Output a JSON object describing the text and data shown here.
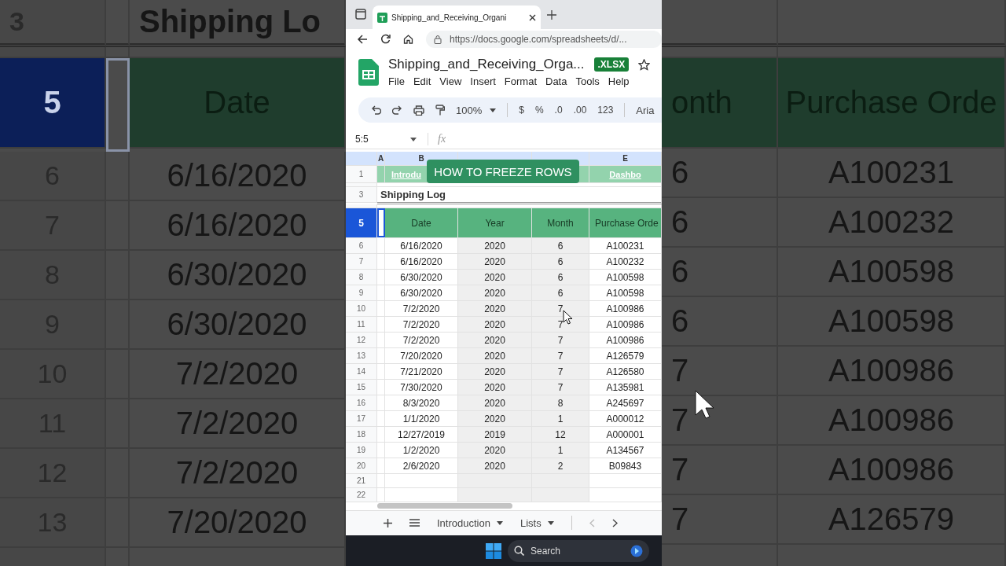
{
  "browser": {
    "tab_title": "Shipping_and_Receiving_Organi",
    "url": "https://docs.google.com/spreadsheets/d/..."
  },
  "document": {
    "title": "Shipping_and_Receiving_Orga...",
    "badge": ".XLSX",
    "menu": [
      "File",
      "Edit",
      "View",
      "Insert",
      "Format",
      "Data",
      "Tools",
      "Help"
    ]
  },
  "toolbar": {
    "zoom": "100%",
    "items": [
      "$",
      "%",
      ".0",
      ".00",
      "123"
    ],
    "font": "Aria"
  },
  "formula_bar": {
    "range": "5:5",
    "fx": "fx"
  },
  "caption": "HOW TO FREEZE ROWS",
  "sheet": {
    "column_a": "A",
    "columns": [
      "B",
      null,
      null,
      "E"
    ],
    "link_row": {
      "number": "1",
      "links": [
        "Introdu",
        "Dashbo"
      ]
    },
    "title_row": {
      "number": "3",
      "text": "Shipping Log"
    },
    "header_row": {
      "number": "5",
      "selected": true,
      "cells": [
        "Date",
        "Year",
        "Month",
        "Purchase Orde"
      ]
    },
    "rows": [
      {
        "number": "6",
        "cells": [
          "6/16/2020",
          "2020",
          "6",
          "A100231"
        ]
      },
      {
        "number": "7",
        "cells": [
          "6/16/2020",
          "2020",
          "6",
          "A100232"
        ]
      },
      {
        "number": "8",
        "cells": [
          "6/30/2020",
          "2020",
          "6",
          "A100598"
        ]
      },
      {
        "number": "9",
        "cells": [
          "6/30/2020",
          "2020",
          "6",
          "A100598"
        ]
      },
      {
        "number": "10",
        "cells": [
          "7/2/2020",
          "2020",
          "7",
          "A100986"
        ]
      },
      {
        "number": "11",
        "cells": [
          "7/2/2020",
          "2020",
          "7",
          "A100986"
        ]
      },
      {
        "number": "12",
        "cells": [
          "7/2/2020",
          "2020",
          "7",
          "A100986"
        ]
      },
      {
        "number": "13",
        "cells": [
          "7/20/2020",
          "2020",
          "7",
          "A126579"
        ]
      },
      {
        "number": "14",
        "cells": [
          "7/21/2020",
          "2020",
          "7",
          "A126580"
        ]
      },
      {
        "number": "15",
        "cells": [
          "7/30/2020",
          "2020",
          "7",
          "A135981"
        ]
      },
      {
        "number": "16",
        "cells": [
          "8/3/2020",
          "2020",
          "8",
          "A245697"
        ]
      },
      {
        "number": "17",
        "cells": [
          "1/1/2020",
          "2020",
          "1",
          "A000012"
        ]
      },
      {
        "number": "18",
        "cells": [
          "12/27/2019",
          "2019",
          "12",
          "A000001"
        ]
      },
      {
        "number": "19",
        "cells": [
          "1/2/2020",
          "2020",
          "1",
          "A134567"
        ]
      },
      {
        "number": "20",
        "cells": [
          "2/6/2020",
          "2020",
          "2",
          "B09843"
        ]
      }
    ],
    "empty_rows": [
      "21",
      "22"
    ]
  },
  "sheet_tabs": [
    {
      "label": "Introduction"
    },
    {
      "label": "Lists"
    }
  ],
  "taskbar": {
    "search": "Search"
  },
  "backdrop_left": {
    "title_row": {
      "number": "3",
      "text": "Shipping Lo"
    },
    "header_row": {
      "number": "5",
      "selected": true,
      "cells": [
        "Date"
      ]
    },
    "rows": [
      {
        "number": "6",
        "cells": [
          "6/16/2020"
        ]
      },
      {
        "number": "7",
        "cells": [
          "6/16/2020"
        ]
      },
      {
        "number": "8",
        "cells": [
          "6/30/2020"
        ]
      },
      {
        "number": "9",
        "cells": [
          "6/30/2020"
        ]
      },
      {
        "number": "10",
        "cells": [
          "7/2/2020"
        ]
      },
      {
        "number": "11",
        "cells": [
          "7/2/2020"
        ]
      },
      {
        "number": "12",
        "cells": [
          "7/2/2020"
        ]
      },
      {
        "number": "13",
        "cells": [
          "7/20/2020"
        ]
      }
    ]
  },
  "backdrop_right": {
    "header_row": {
      "cells": [
        "onth",
        "Purchase Orde"
      ]
    },
    "rows": [
      {
        "cells": [
          "6",
          "A100231"
        ]
      },
      {
        "cells": [
          "6",
          "A100232"
        ]
      },
      {
        "cells": [
          "6",
          "A100598"
        ]
      },
      {
        "cells": [
          "6",
          "A100598"
        ]
      },
      {
        "cells": [
          "7",
          "A100986"
        ]
      },
      {
        "cells": [
          "7",
          "A100986"
        ]
      },
      {
        "cells": [
          "7",
          "A100986"
        ]
      },
      {
        "cells": [
          "7",
          "A126579"
        ]
      }
    ]
  }
}
